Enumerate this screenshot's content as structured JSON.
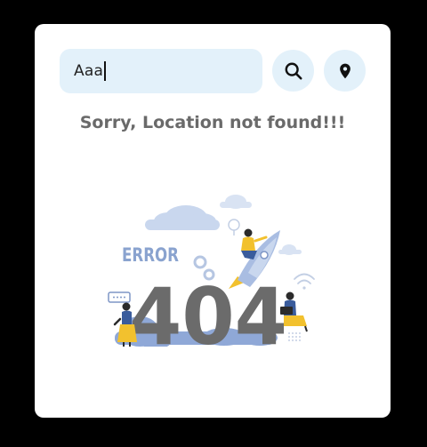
{
  "search": {
    "value": "Aaa"
  },
  "buttons": {
    "search_icon": "search-icon",
    "location_icon": "location-pin-icon"
  },
  "message": {
    "text": "Sorry, Location not found!!!"
  },
  "illustration": {
    "error_label": "ERROR",
    "code": "404"
  },
  "colors": {
    "background": "#000000",
    "card": "#ffffff",
    "input_bg": "#e3f1fa",
    "message_text": "#6a6a6a",
    "digits": "#6b6b6b",
    "error_label": "#8aa3cf",
    "clouds": "#c9d7ee",
    "accent_yellow": "#f2c12e",
    "accent_blue": "#3a5c9c"
  }
}
